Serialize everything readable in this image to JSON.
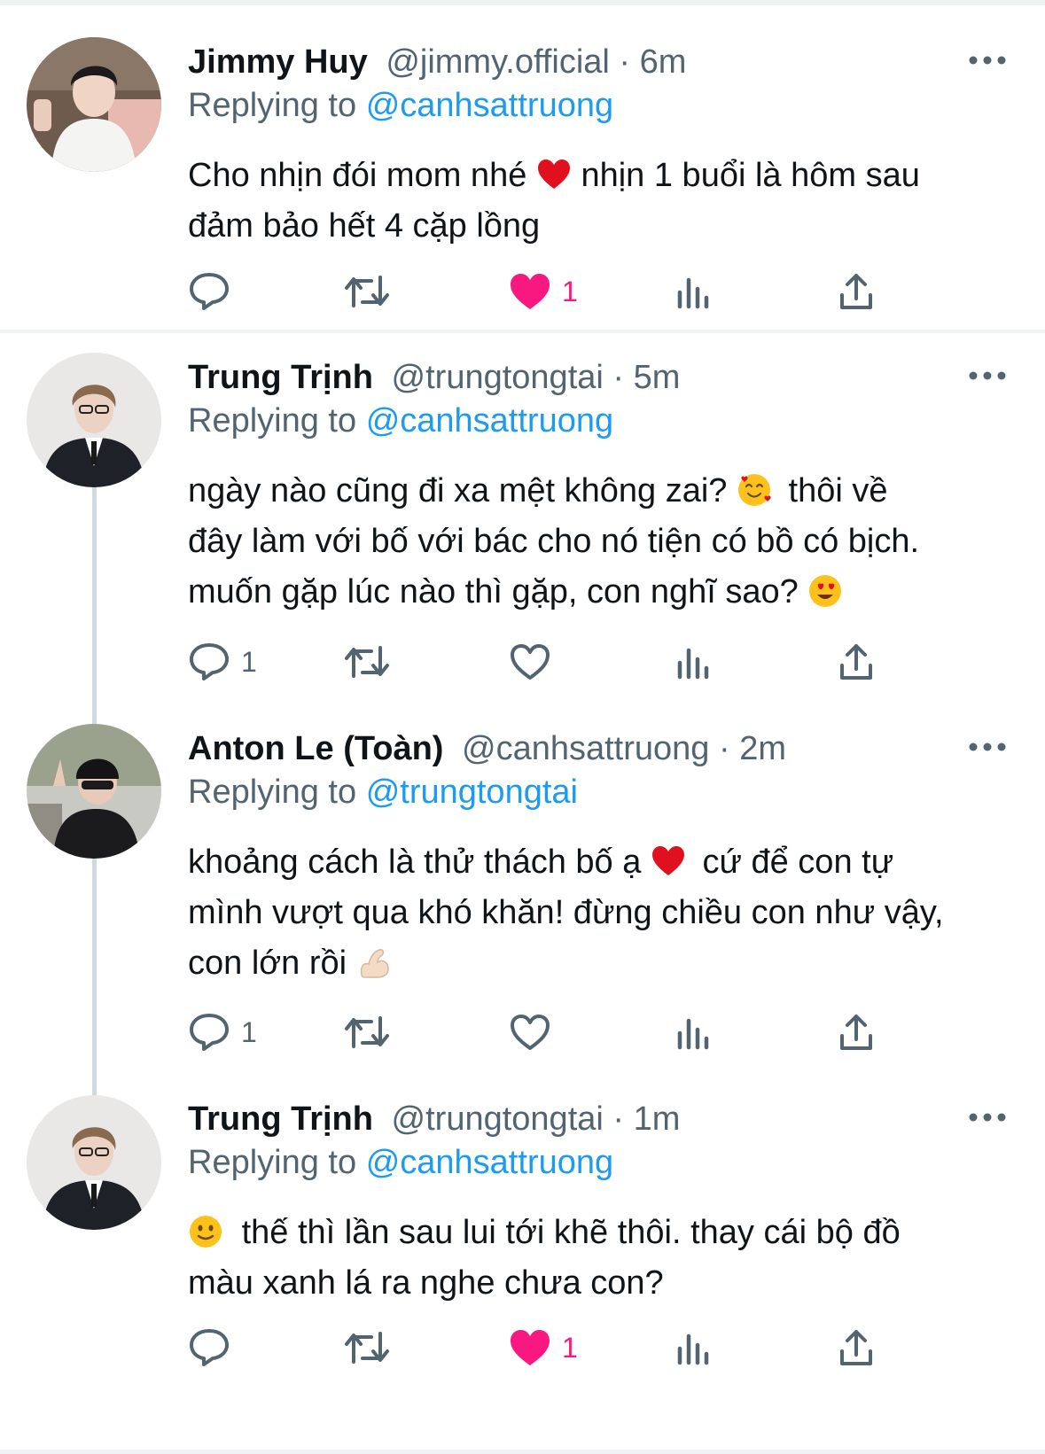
{
  "colors": {
    "link": "#1d9bf0",
    "like": "#f91880",
    "muted": "#536471",
    "text": "#0f1419"
  },
  "tweets": [
    {
      "name": "Jimmy Huy",
      "handle": "@jimmy.official",
      "time": "6m",
      "replying_label": "Replying to",
      "replying_to": "@canhsattruong",
      "content_lines": [
        "Cho nhịn đói mom nhé",
        "nhịn 1 buổi là hôm sau",
        "đảm bảo hết 4 cặp lồng"
      ],
      "reply_count": "",
      "like_count": "1",
      "liked": true
    },
    {
      "name": "Trung Trịnh",
      "handle": "@trungtongtai",
      "time": "5m",
      "replying_label": "Replying to",
      "replying_to": "@canhsattruong",
      "content_lines": [
        "ngày nào cũng đi xa mệt không zai?",
        "thôi về",
        "đây làm với bố với bác cho nó tiện có bồ có bịch.",
        "muốn gặp lúc nào thì gặp, con nghĩ sao?"
      ],
      "reply_count": "1",
      "like_count": "",
      "liked": false
    },
    {
      "name": "Anton Le (Toàn)",
      "handle": "@canhsattruong",
      "time": "2m",
      "replying_label": "Replying to",
      "replying_to": "@trungtongtai",
      "content_lines": [
        "khoảng cách là thử thách bố ạ",
        "cứ để con tự",
        "mình vượt qua khó khăn! đừng chiều con như vậy,",
        "con lớn rồi"
      ],
      "reply_count": "1",
      "like_count": "",
      "liked": false
    },
    {
      "name": "Trung Trịnh",
      "handle": "@trungtongtai",
      "time": "1m",
      "replying_label": "Replying to",
      "replying_to": "@canhsattruong",
      "content_lines": [
        "thế thì lần sau lui tới khẽ thôi. thay cái bộ đồ",
        "màu xanh lá ra nghe chưa con?"
      ],
      "reply_count": "",
      "like_count": "1",
      "liked": true
    }
  ],
  "separator": "·"
}
